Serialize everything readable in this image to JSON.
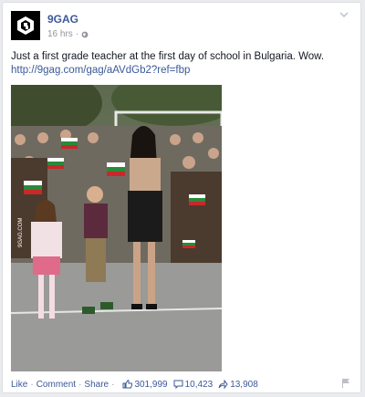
{
  "page": {
    "name": "9GAG",
    "time": "16 hrs",
    "separator": "·"
  },
  "post": {
    "text": "Just a first grade teacher at the first day of school in Bulgaria. Wow.",
    "link": "http://9gag.com/gag/aAVdGb2?ref=fbp",
    "watermark": "9GAG.COM"
  },
  "actions": {
    "like": "Like",
    "comment": "Comment",
    "share": "Share",
    "dot": "·"
  },
  "stats": {
    "likes": "301,999",
    "comments": "10,423",
    "shares": "13,908"
  },
  "colors": {
    "link": "#3b5998",
    "muted": "#90949c"
  }
}
